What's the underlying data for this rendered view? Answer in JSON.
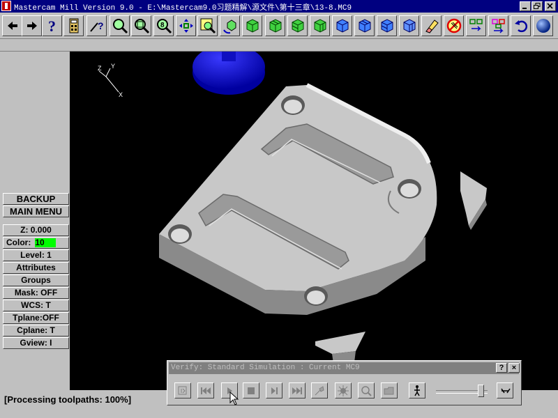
{
  "window": {
    "title": "Mastercam Mill Version 9.0 - E:\\Mastercam9.0习题精解\\源文件\\第十三章\\13-8.MC9"
  },
  "toolbar": {
    "buttons": [
      {
        "icon": "arrow-left-icon"
      },
      {
        "icon": "arrow-right-icon"
      },
      {
        "icon": "help-icon"
      },
      {
        "icon": "calculator-icon"
      },
      {
        "icon": "analyze-icon"
      },
      {
        "icon": "zoom-icon"
      },
      {
        "icon": "zoom-out-icon"
      },
      {
        "icon": "zoom-fit-icon"
      },
      {
        "icon": "pan-icon"
      },
      {
        "icon": "screen-zoom-icon"
      },
      {
        "icon": "rotate-view-icon"
      },
      {
        "icon": "view-cube-iso-icon"
      },
      {
        "icon": "view-cube-top-icon"
      },
      {
        "icon": "view-cube-front-icon"
      },
      {
        "icon": "view-cube-side-icon"
      },
      {
        "icon": "cube-blue-1-icon"
      },
      {
        "icon": "cube-blue-2-icon"
      },
      {
        "icon": "cube-blue-3-icon"
      },
      {
        "icon": "cube-blue-4-icon"
      },
      {
        "icon": "eraser-icon"
      },
      {
        "icon": "delete-icon"
      },
      {
        "icon": "toolpath-1-icon"
      },
      {
        "icon": "toolpath-2-icon"
      },
      {
        "icon": "undo-icon"
      },
      {
        "icon": "shade-sphere-icon"
      }
    ]
  },
  "left_menu": {
    "backup": "BACKUP",
    "main_menu": "MAIN MENU",
    "z": "Z:  0.000",
    "color_label": "Color:",
    "color_value": "10",
    "level": "Level:  1",
    "attributes": "Attributes",
    "groups": "Groups",
    "mask": "Mask:  OFF",
    "wcs": "WCS:   T",
    "tplane": "Tplane:OFF",
    "cplane": "Cplane:  T",
    "gview": "Gview:   I"
  },
  "axis": {
    "z": "Z",
    "y": "Y",
    "x": "X"
  },
  "status": {
    "text": "[Processing toolpaths:  100%]"
  },
  "verify": {
    "title": "Verify: Standard Simulation : Current MC9",
    "help": "?",
    "close": "×",
    "speed_fraction": 0.92
  },
  "colors": {
    "title_bar": "#000080",
    "viewport_bg": "#000000",
    "part": "#c8c8c8",
    "tool": "#1a1ad0",
    "color_swatch": "#00ff00"
  }
}
